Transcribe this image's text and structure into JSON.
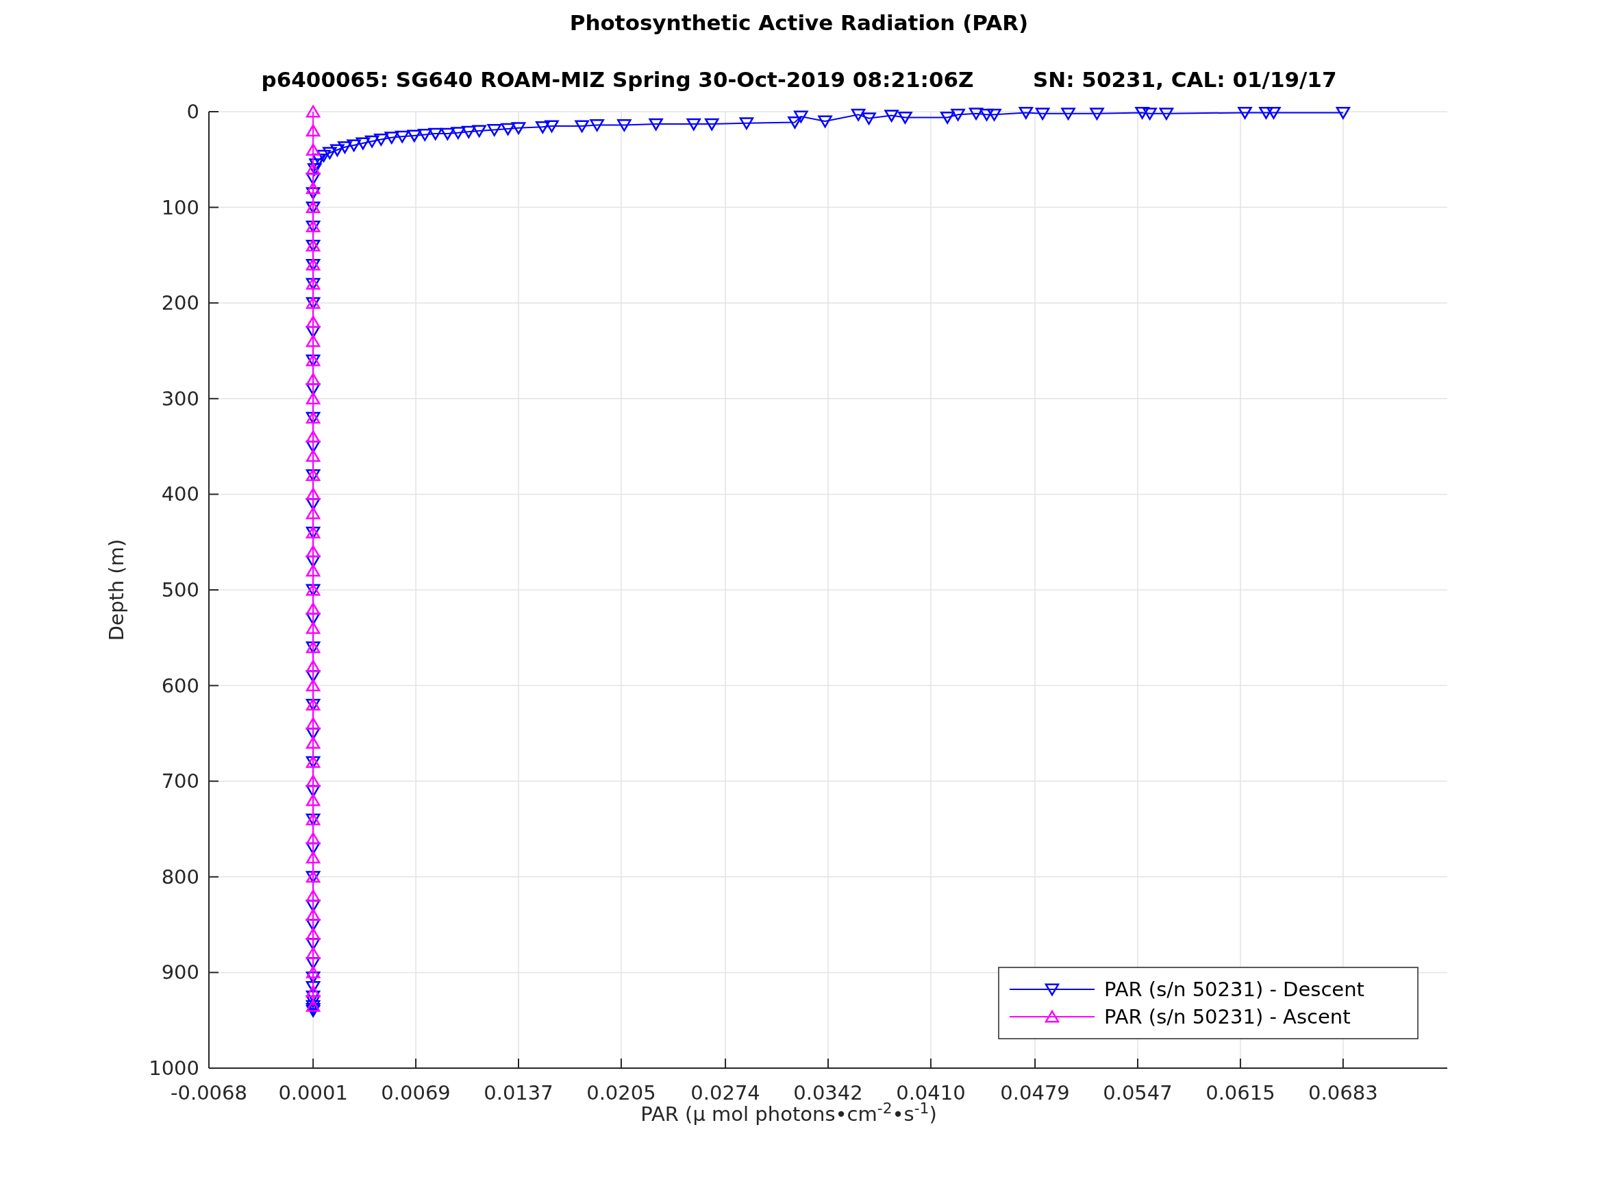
{
  "figure": {
    "title": "Photosynthetic Active Radiation (PAR)",
    "subtitle": "p6400065: SG640 ROAM-MIZ Spring 30-Oct-2019 08:21:06Z        SN: 50231, CAL: 01/19/17",
    "chart_data": {
      "type": "line",
      "xlabel": "PAR (μ mol photons•cm$^{-2}$•s$^{-1}$)",
      "ylabel": "Depth (m)",
      "orientation": "horizontal",
      "grid": true,
      "legend": true,
      "xlim": [
        -0.0068,
        0.0752
      ],
      "ylim": [
        1000,
        0
      ],
      "xticks": [
        {
          "value": -0.0068,
          "label": "-0.0068"
        },
        {
          "value": 0.0001,
          "label": "0.0001"
        },
        {
          "value": 0.0069,
          "label": "0.0069"
        },
        {
          "value": 0.0137,
          "label": "0.0137"
        },
        {
          "value": 0.0205,
          "label": "0.0205"
        },
        {
          "value": 0.0274,
          "label": "0.0274"
        },
        {
          "value": 0.0342,
          "label": "0.0342"
        },
        {
          "value": 0.041,
          "label": "0.0410"
        },
        {
          "value": 0.0479,
          "label": "0.0479"
        },
        {
          "value": 0.0547,
          "label": "0.0547"
        },
        {
          "value": 0.0615,
          "label": "0.0615"
        },
        {
          "value": 0.0683,
          "label": "0.0683"
        }
      ],
      "yticks": [
        0,
        100,
        200,
        300,
        400,
        500,
        600,
        700,
        800,
        900,
        1000
      ],
      "series": [
        {
          "name": "PAR (s/n 50231) - Descent",
          "color": "#0000ff",
          "marker": "triangle",
          "values": [
            0.0683,
            0.0637,
            0.0632,
            0.0618,
            0.0566,
            0.0555,
            0.055,
            0.052,
            0.0501,
            0.0484,
            0.0473,
            0.0452,
            0.0447,
            0.044,
            0.0428,
            0.0421,
            0.0393,
            0.0384,
            0.0369,
            0.0362,
            0.034,
            0.0324,
            0.032,
            0.0288,
            0.0265,
            0.0253,
            0.0228,
            0.0207,
            0.0189,
            0.0179,
            0.0159,
            0.0153,
            0.0137,
            0.013,
            0.0121,
            0.0111,
            0.0104,
            0.0097,
            0.009,
            0.0082,
            0.0075,
            0.0068,
            0.006,
            0.0053,
            0.0046,
            0.004,
            0.0034,
            0.0028,
            0.0022,
            0.0017,
            0.0012,
            0.0008,
            0.0005,
            0.0003,
            0.0002,
            0.0001,
            0.0001,
            0.0001,
            0.0001,
            0.0001,
            0.0001,
            0.0001,
            0.0001,
            0.0001,
            0.0001,
            0.0001,
            0.0001,
            0.0001,
            0.0001,
            0.0001,
            0.0001,
            0.0001,
            0.0001,
            0.0001,
            0.0001,
            0.0001,
            0.0001,
            0.0001,
            0.0001,
            0.0001,
            0.0001,
            0.0001,
            0.0001,
            0.0001,
            0.0001,
            0.0001,
            0.0001,
            0.0001,
            0.0001,
            0.0001,
            0.0001,
            0.0001,
            0.0001,
            0.0001
          ],
          "x": [
            1,
            1,
            1,
            1,
            2,
            2,
            1,
            2,
            2,
            2,
            1,
            3,
            3,
            2,
            3,
            6,
            6,
            4,
            7,
            3,
            10,
            5,
            11,
            12,
            13,
            13,
            13,
            14,
            14,
            15,
            15,
            16,
            17,
            18,
            19,
            20,
            21,
            22,
            23,
            23,
            24,
            25,
            26,
            27,
            29,
            31,
            33,
            35,
            37,
            40,
            43,
            46,
            50,
            55,
            60,
            70,
            85,
            100,
            120,
            140,
            160,
            180,
            200,
            230,
            260,
            290,
            320,
            350,
            380,
            410,
            440,
            470,
            500,
            530,
            560,
            590,
            620,
            650,
            680,
            710,
            740,
            770,
            800,
            830,
            850,
            870,
            890,
            905,
            915,
            925,
            930,
            935,
            938,
            940
          ]
        },
        {
          "name": "PAR (s/n 50231) - Ascent",
          "color": "#ff00ff",
          "marker": "triangle",
          "values": [
            0.0001,
            0.0001,
            0.0001,
            0.0001,
            0.0001,
            0.0001,
            0.0001,
            0.0001,
            0.0001,
            0.0001,
            0.0001,
            0.0001,
            0.0001,
            0.0001,
            0.0001,
            0.0001,
            0.0001,
            0.0001,
            0.0001,
            0.0001,
            0.0001,
            0.0001,
            0.0001,
            0.0001,
            0.0001,
            0.0001,
            0.0001,
            0.0001,
            0.0001,
            0.0001,
            0.0001,
            0.0001,
            0.0001,
            0.0001,
            0.0001,
            0.0001,
            0.0001,
            0.0001,
            0.0001,
            0.0001,
            0.0001,
            0.0001,
            0.0001,
            0.0001,
            0.0001,
            0.0001,
            0.0001,
            0.0001
          ],
          "x": [
            0,
            20,
            40,
            60,
            80,
            100,
            120,
            140,
            160,
            180,
            200,
            220,
            240,
            260,
            280,
            300,
            320,
            340,
            360,
            380,
            400,
            420,
            440,
            460,
            480,
            500,
            520,
            540,
            560,
            580,
            600,
            620,
            640,
            660,
            680,
            700,
            720,
            740,
            760,
            780,
            800,
            820,
            840,
            860,
            880,
            900,
            920,
            935
          ]
        }
      ]
    }
  }
}
